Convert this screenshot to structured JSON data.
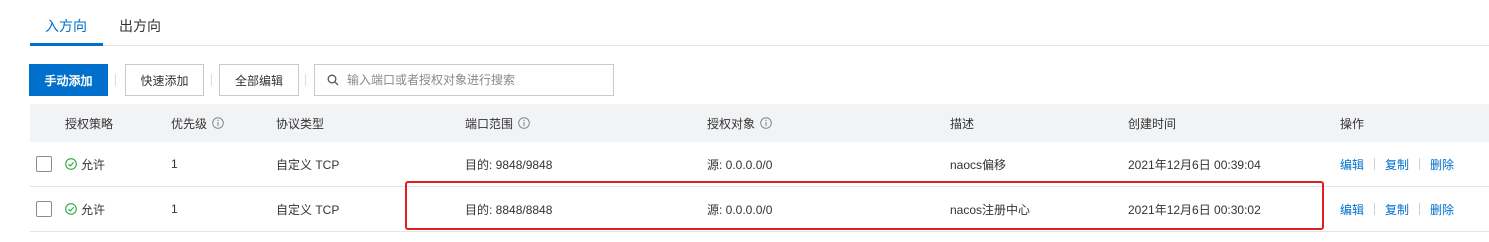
{
  "tabs": [
    {
      "label": "入方向",
      "active": true
    },
    {
      "label": "出方向",
      "active": false
    }
  ],
  "toolbar": {
    "manual_add": "手动添加",
    "quick_add": "快速添加",
    "edit_all": "全部编辑",
    "search_placeholder": "输入端口或者授权对象进行搜索"
  },
  "table": {
    "headers": {
      "policy": "授权策略",
      "priority": "优先级",
      "protocol": "协议类型",
      "port_range": "端口范围",
      "auth_object": "授权对象",
      "description": "描述",
      "created": "创建时间",
      "actions": "操作"
    },
    "rows": [
      {
        "policy": "允许",
        "priority": "1",
        "protocol": "自定义 TCP",
        "port_range": "目的: 9848/9848",
        "auth_object": "源: 0.0.0.0/0",
        "description": "naocs偏移",
        "created": "2021年12月6日 00:39:04",
        "edit": "编辑",
        "copy": "复制",
        "delete": "删除"
      },
      {
        "policy": "允许",
        "priority": "1",
        "protocol": "自定义 TCP",
        "port_range": "目的: 8848/8848",
        "auth_object": "源: 0.0.0.0/0",
        "description": "nacos注册中心",
        "created": "2021年12月6日 00:30:02",
        "edit": "编辑",
        "copy": "复制",
        "delete": "删除",
        "highlighted": true
      }
    ]
  },
  "colors": {
    "accent": "#0070cc",
    "allow_green": "#2da641",
    "highlight_red": "#e02020",
    "header_bg": "#f2f3f5"
  },
  "icons": {
    "search": "search-icon",
    "info": "info-circle-icon",
    "allow": "check-circle-icon"
  }
}
